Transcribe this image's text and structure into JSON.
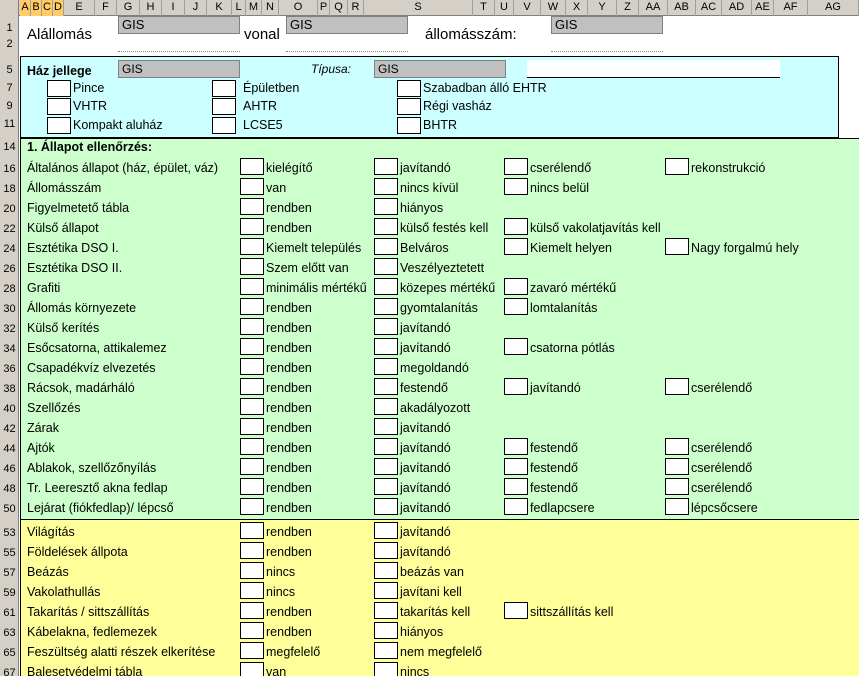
{
  "column_headers": [
    "A",
    "B",
    "C",
    "D",
    "E",
    "F",
    "G",
    "H",
    "I",
    "J",
    "K",
    "L",
    "M",
    "N",
    "O",
    "P",
    "Q",
    "R",
    "S",
    "T",
    "U",
    "V",
    "W",
    "X",
    "Y",
    "Z",
    "AA",
    "AB",
    "AC",
    "AD",
    "AE",
    "AF",
    "AG"
  ],
  "header_rows": {
    "allomas_label": "Alállomás",
    "allomas_value": "GIS",
    "vonal_label": "vonal",
    "vonal_value": "GIS",
    "allomasszam_label": "állomásszám:",
    "allomasszam_value": "GIS"
  },
  "haz_jellege": {
    "label": "Ház jellege",
    "value": "GIS",
    "tipusa_label": "Típusa:",
    "tipusa_value": "GIS",
    "options": [
      "Pince",
      "VHTR",
      "Kompakt aluház",
      "Épületben",
      "AHTR",
      "LCSE5",
      "Szabadban álló EHTR",
      "Régi vasház",
      "BHTR"
    ]
  },
  "section1_title": "1. Állapot ellenőrzés:",
  "rows": [
    {
      "num": "16",
      "label": "Általános állapot (ház, épület, váz)",
      "opts": [
        "kielégítő",
        "javítandó",
        "cserélendő",
        "rekonstrukció"
      ]
    },
    {
      "num": "18",
      "label": "Állomásszám",
      "opts": [
        "van",
        "nincs kívül",
        "nincs belül"
      ]
    },
    {
      "num": "20",
      "label": "Figyelmetető tábla",
      "opts": [
        "rendben",
        "hiányos"
      ]
    },
    {
      "num": "22",
      "label": "Külső állapot",
      "opts": [
        "rendben",
        "külső festés kell",
        "külső vakolatjavítás kell"
      ]
    },
    {
      "num": "24",
      "label": "Esztétika DSO I.",
      "opts": [
        "Kiemelt település",
        "Belváros",
        "Kiemelt helyen",
        "Nagy forgalmú hely"
      ]
    },
    {
      "num": "26",
      "label": "Esztétika DSO II.",
      "opts": [
        "Szem előtt van",
        "Veszélyeztetett"
      ]
    },
    {
      "num": "28",
      "label": "Grafiti",
      "opts": [
        "minimális mértékű",
        "közepes mértékű",
        "zavaró mértékű"
      ]
    },
    {
      "num": "30",
      "label": "Állomás környezete",
      "opts": [
        "rendben",
        "gyomtalanítás",
        "lomtalanítás"
      ]
    },
    {
      "num": "32",
      "label": "Külső kerítés",
      "opts": [
        "rendben",
        "javítandó"
      ]
    },
    {
      "num": "34",
      "label": "Esőcsatorna, attikalemez",
      "opts": [
        "rendben",
        "javítandó",
        "csatorna pótlás"
      ]
    },
    {
      "num": "36",
      "label": "Csapadékvíz elvezetés",
      "opts": [
        "rendben",
        "megoldandó"
      ]
    },
    {
      "num": "38",
      "label": "Rácsok, madárháló",
      "opts": [
        "rendben",
        "festendő",
        "javítandó",
        "cserélendő"
      ]
    },
    {
      "num": "40",
      "label": "Szellőzés",
      "opts": [
        "rendben",
        "akadályozott"
      ]
    },
    {
      "num": "42",
      "label": "Zárak",
      "opts": [
        "rendben",
        "javítandó"
      ]
    },
    {
      "num": "44",
      "label": "Ajtók",
      "opts": [
        "rendben",
        "javítandó",
        "festendő",
        "cserélendő"
      ]
    },
    {
      "num": "46",
      "label": "Ablakok, szellőzőnyílás",
      "opts": [
        "rendben",
        "javítandó",
        "festendő",
        "cserélendő"
      ]
    },
    {
      "num": "48",
      "label": "Tr. Leeresztő akna fedlap",
      "opts": [
        "rendben",
        "javítandó",
        "festendő",
        "cserélendő"
      ]
    },
    {
      "num": "50",
      "label": "Lejárat (fiókfedlap)/ lépcső",
      "opts": [
        "rendben",
        "javítandó",
        "fedlapcsere",
        "lépcsőcsere"
      ]
    }
  ],
  "rows2": [
    {
      "num": "53",
      "label": "Világítás",
      "opts": [
        "rendben",
        "javítandó"
      ]
    },
    {
      "num": "55",
      "label": "Földelések állpota",
      "opts": [
        "rendben",
        "javítandó"
      ]
    },
    {
      "num": "57",
      "label": "Beázás",
      "opts": [
        "nincs",
        "beázás van"
      ]
    },
    {
      "num": "59",
      "label": "Vakolathullás",
      "opts": [
        "nincs",
        "javítani kell"
      ]
    },
    {
      "num": "61",
      "label": "Takarítás / sittszállítás",
      "opts": [
        "rendben",
        "takarítás kell",
        "sittszállítás kell"
      ]
    },
    {
      "num": "63",
      "label": "Kábelakna, fedlemezek",
      "opts": [
        "rendben",
        "hiányos"
      ]
    },
    {
      "num": "65",
      "label": "Feszültség alatti részek elkerítése",
      "opts": [
        "megfelelő",
        "nem megfelelő"
      ]
    },
    {
      "num": "67",
      "label": "Balesetvédelmi tábla",
      "opts": [
        "van",
        "nincs"
      ]
    }
  ],
  "row_numbers_top": [
    "1",
    "2",
    "5",
    "7",
    "9",
    "11",
    "14"
  ],
  "colors": {
    "cyan": "#ccffff",
    "green": "#ccffcc",
    "yellow": "#ffff99",
    "header_gray": "#d4d0c8",
    "selected_col": "#ffcc66"
  }
}
